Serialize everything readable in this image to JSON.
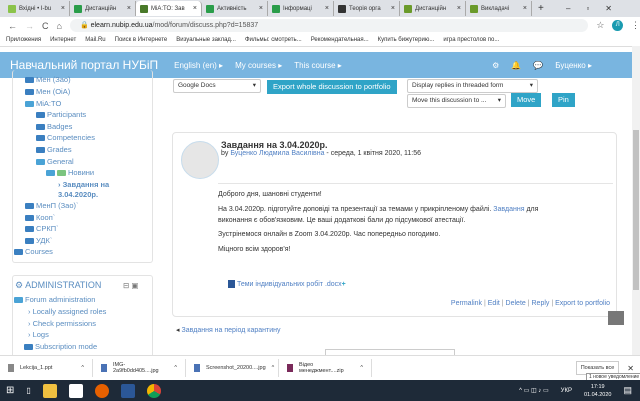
{
  "browser": {
    "tabs": [
      {
        "label": "Вхідні • I-bu"
      },
      {
        "label": "Дистанційн"
      },
      {
        "label": "MiA:TO: Зав",
        "active": true
      },
      {
        "label": "Активність"
      },
      {
        "label": "Інформаці"
      },
      {
        "label": "Теорія орга"
      },
      {
        "label": "Дистанційн"
      },
      {
        "label": "Викладачі"
      }
    ],
    "url_host": "elearn.nubip.edu.ua",
    "url_path": "/mod/forum/discuss.php?d=15837",
    "bookmarks": [
      "Приложения",
      "Интернет",
      "Mail.Ru",
      "Поиск в Интернете",
      "Визуальные заклад...",
      "Фильмы: смотреть...",
      "Рекомендательная...",
      "Купить бижутерию...",
      "игра престолов по..."
    ],
    "avatar_letter": "Л"
  },
  "navbar": {
    "brand": "Навчальний портал НУБіП",
    "language": "English (en) ▸",
    "my_courses": "My courses ▸",
    "this_course": "This course ▸",
    "user": "Буценко ▸"
  },
  "sidebar": {
    "tree": [
      "Мен (Зао)",
      "Мен (ОіА)",
      "MiA:TO",
      "Participants",
      "Badges",
      "Competencies",
      "Grades",
      "General",
      "Новини",
      "Завдання на",
      "3.04.2020р.",
      "МенП (Зао)`",
      "Кооп`",
      "СРКП`",
      "УДК`",
      "Courses"
    ],
    "admin": {
      "title": "ADMINISTRATION",
      "items": [
        "Forum administration",
        "Locally assigned roles",
        "Check permissions",
        "Logs",
        "Subscription mode"
      ]
    }
  },
  "toolbar": {
    "portfolio_select": "Google Docs",
    "export_button": "Export whole discussion to portfolio",
    "display_select": "Display replies in threaded form",
    "move_select": "Move this discussion to ...",
    "move_button": "Move",
    "pin_button": "Pin"
  },
  "post": {
    "subject": "Завдання на 3.04.2020р.",
    "by": "by",
    "author": "Буценко Людмила Василівна",
    "date": " - середа, 1 квітня 2020, 11:56",
    "p1": "Доброго дня, шановні студенти!",
    "p2a": "На 3.04.2020р. підготуйте доповіді та презентації за темами у прикріпленому файлі. ",
    "p2link": "Завдання",
    "p2b": " для",
    "p2c": "виконання є обов'язковим. Це ваші додаткові бали до підсумкової атестації.",
    "p3": "Зустрінемося онлайн в Zoom 3.04.2020р. Час попередньо погодимо.",
    "p4": "Міцного всім здоров'я!",
    "attachment": "Теми індивідуальних робіт .docx",
    "actions": [
      "Permalink",
      "Edit",
      "Delete",
      "Reply",
      "Export to portfolio"
    ]
  },
  "prev_link": "Завдання на період карантину",
  "downloads": {
    "items": [
      "Lekcija_1.ppt",
      "IMG-2a9fb0dd405....jpg",
      "Screenshot_20200....jpg",
      "Відео менеджмент....zip"
    ],
    "show_all": "Показать все",
    "notification": "1 новое уведомление"
  },
  "taskbar": {
    "lang": "УКР",
    "time": "17:19",
    "date": "01.04.2020"
  }
}
